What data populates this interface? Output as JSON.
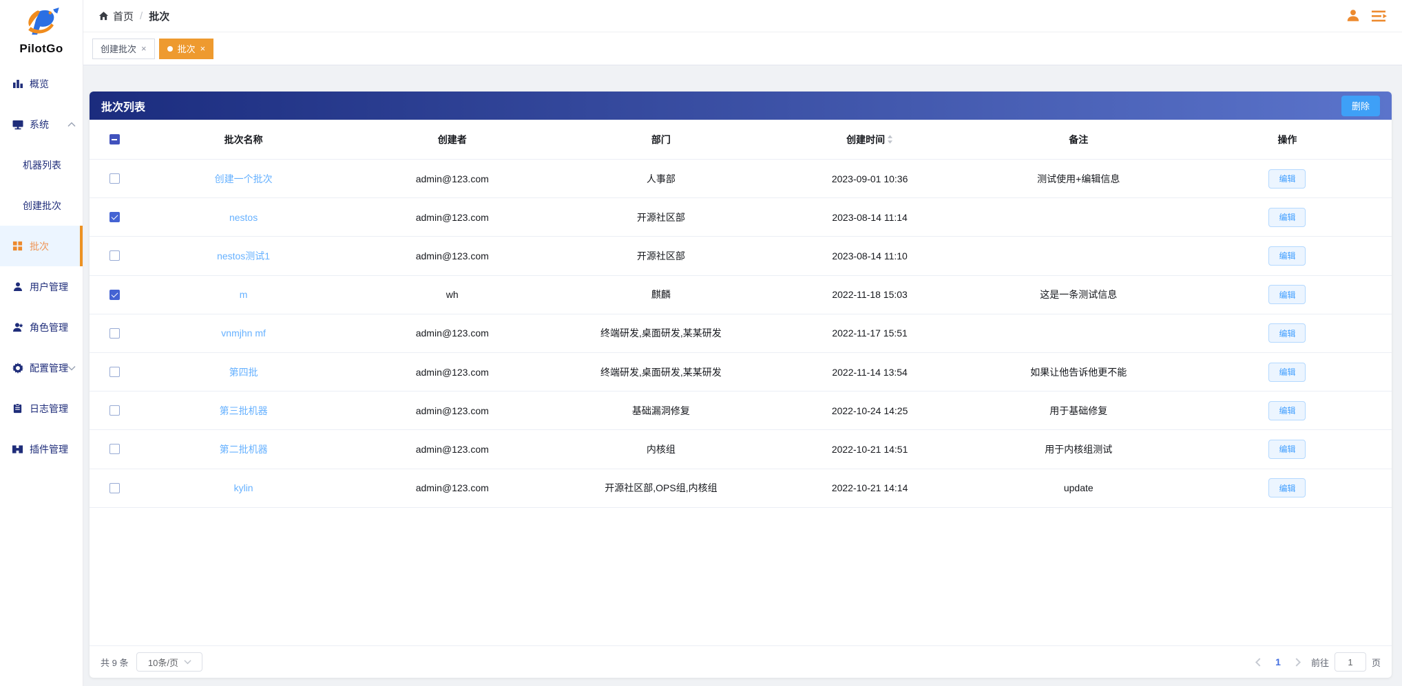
{
  "brand": {
    "name": "PilotGo"
  },
  "breadcrumb": {
    "home": "首页",
    "separator": "/",
    "current": "批次"
  },
  "tabs": [
    {
      "id": "create-batch",
      "label": "创建批次",
      "close": "×",
      "active": false
    },
    {
      "id": "batch",
      "label": "批次",
      "close": "×",
      "active": true
    }
  ],
  "sidebar": {
    "items": [
      {
        "id": "overview",
        "label": "概览",
        "icon": "bar-chart-icon",
        "level": 1
      },
      {
        "id": "system",
        "label": "系统",
        "icon": "monitor-icon",
        "level": 1,
        "chevron": "up"
      },
      {
        "id": "machine-list",
        "label": "机器列表",
        "level": 2
      },
      {
        "id": "create-batch",
        "label": "创建批次",
        "level": 2
      },
      {
        "id": "batch",
        "label": "批次",
        "icon": "grid-icon",
        "level": 2,
        "active": true
      },
      {
        "id": "user-mgmt",
        "label": "用户管理",
        "icon": "user-icon",
        "level": 1
      },
      {
        "id": "role-mgmt",
        "label": "角色管理",
        "icon": "role-icon",
        "level": 1
      },
      {
        "id": "config-mgmt",
        "label": "配置管理",
        "icon": "gear-icon",
        "level": 1,
        "chevron": "down"
      },
      {
        "id": "log-mgmt",
        "label": "日志管理",
        "icon": "log-icon",
        "level": 1
      },
      {
        "id": "plugin-mgmt",
        "label": "插件管理",
        "icon": "plugin-icon",
        "level": 1
      }
    ]
  },
  "panel": {
    "title": "批次列表",
    "delete_button": "删除"
  },
  "table": {
    "columns": [
      {
        "label": "批次名称"
      },
      {
        "label": "创建者"
      },
      {
        "label": "部门"
      },
      {
        "label": "创建时间",
        "sortable": true
      },
      {
        "label": "备注"
      },
      {
        "label": "操作"
      }
    ],
    "edit_button": "编辑",
    "header_checkbox_state": "indeterminate",
    "rows": [
      {
        "name": "创建一个批次",
        "creator": "admin@123.com",
        "dept": "人事部",
        "time": "2023-09-01 10:36",
        "note": "测试使用+编辑信息",
        "checked": false
      },
      {
        "name": "nestos",
        "creator": "admin@123.com",
        "dept": "开源社区部",
        "time": "2023-08-14 11:14",
        "note": "",
        "checked": true
      },
      {
        "name": "nestos测试1",
        "creator": "admin@123.com",
        "dept": "开源社区部",
        "time": "2023-08-14 11:10",
        "note": "",
        "checked": false
      },
      {
        "name": "m",
        "creator": "wh",
        "dept": "麒麟",
        "time": "2022-11-18 15:03",
        "note": "这是一条测试信息",
        "checked": true
      },
      {
        "name": "vnmjhn mf",
        "creator": "admin@123.com",
        "dept": "终端研发,桌面研发,某某研发",
        "time": "2022-11-17 15:51",
        "note": "",
        "checked": false
      },
      {
        "name": "第四批",
        "creator": "admin@123.com",
        "dept": "终端研发,桌面研发,某某研发",
        "time": "2022-11-14 13:54",
        "note": "如果让他告诉他更不能",
        "checked": false
      },
      {
        "name": "第三批机器",
        "creator": "admin@123.com",
        "dept": "基础漏洞修复",
        "time": "2022-10-24 14:25",
        "note": "用于基础修复",
        "checked": false
      },
      {
        "name": "第二批机器",
        "creator": "admin@123.com",
        "dept": "内核组",
        "time": "2022-10-21 14:51",
        "note": "用于内核组测试",
        "checked": false
      },
      {
        "name": "kylin",
        "creator": "admin@123.com",
        "dept": "开源社区部,OPS组,内核组",
        "time": "2022-10-21 14:14",
        "note": "update",
        "checked": false
      }
    ]
  },
  "pagination": {
    "total": "共 9 条",
    "page_size": "10条/页",
    "prev": "‹",
    "next": "›",
    "current_page": "1",
    "goto_label": "前往",
    "goto_value": "1",
    "page_suffix": "页"
  },
  "colors": {
    "accent_orange": "#ee9a2f",
    "navy": "#1f2d7a",
    "header_gradient_start": "#1b2c7e",
    "header_gradient_end": "#5b74cb",
    "link_blue": "#66b1ff",
    "primary_button_blue": "#3ea0f7",
    "checkbox_checked": "#4463d3",
    "page_active_blue": "#436ee0"
  }
}
